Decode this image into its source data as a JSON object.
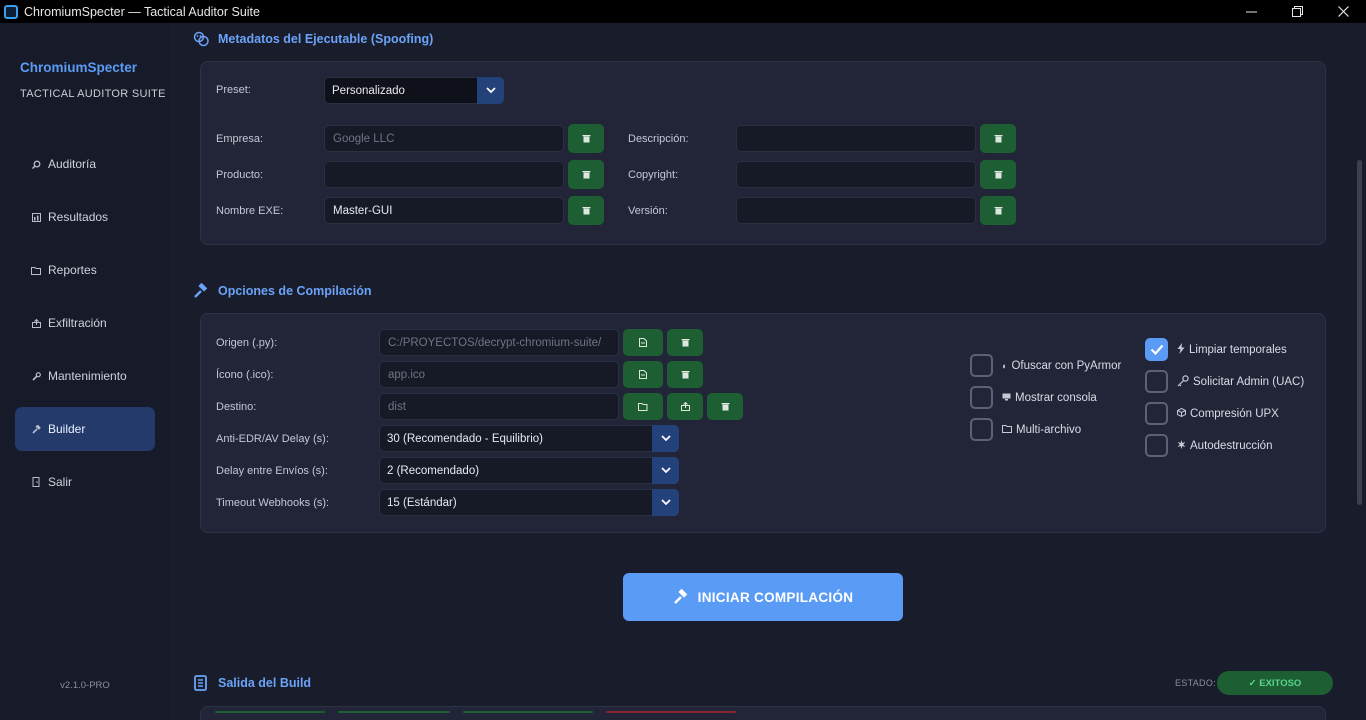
{
  "window": {
    "title": "ChromiumSpecter — Tactical Auditor Suite",
    "controls": {
      "minimize": "—",
      "restore": "❐",
      "close": "✕"
    }
  },
  "sidebar": {
    "brand": "ChromiumSpecter",
    "subtitle": "TACTICAL AUDITOR SUITE",
    "items": [
      {
        "label": "Auditoría",
        "icon": "magnifier-icon"
      },
      {
        "label": "Resultados",
        "icon": "chart-icon"
      },
      {
        "label": "Reportes",
        "icon": "folder-icon"
      },
      {
        "label": "Exfiltración",
        "icon": "upload-icon"
      },
      {
        "label": "Mantenimiento",
        "icon": "wrench-icon"
      },
      {
        "label": "Builder",
        "icon": "hammer-icon",
        "active": true
      },
      {
        "label": "Salir",
        "icon": "exit-icon"
      }
    ],
    "version": "v2.1.0-PRO"
  },
  "metadata": {
    "title": "Metadatos del Ejecutable (Spoofing)",
    "preset_label": "Preset:",
    "preset_value": "Personalizado",
    "fields": {
      "empresa": {
        "label": "Empresa:",
        "placeholder": "Google LLC",
        "value": ""
      },
      "producto": {
        "label": "Producto:",
        "value": ""
      },
      "nombre_exe": {
        "label": "Nombre EXE:",
        "value": "Master-GUI"
      },
      "descripcion": {
        "label": "Descripción:",
        "value": ""
      },
      "copyright": {
        "label": "Copyright:",
        "value": ""
      },
      "version": {
        "label": "Versión:",
        "value": ""
      }
    }
  },
  "compile": {
    "title": "Opciones de Compilación",
    "origen": {
      "label": "Origen (.py):",
      "placeholder": "C:/PROYECTOS/decrypt-chromium-suite/"
    },
    "icono": {
      "label": "Ícono (.ico):",
      "placeholder": "app.ico"
    },
    "destino": {
      "label": "Destino:",
      "placeholder": "dist"
    },
    "anti_edr": {
      "label": "Anti-EDR/AV Delay (s):",
      "value": "30 (Recomendado - Equilibrio)"
    },
    "delay_envios": {
      "label": "Delay entre Envíos (s):",
      "value": "2 (Recomendado)"
    },
    "timeout": {
      "label": "Timeout Webhooks (s):",
      "value": "15 (Estándar)"
    },
    "options_left": [
      {
        "label": "Ofuscar con PyArmor",
        "checked": false,
        "icon": "half-circle-icon"
      },
      {
        "label": "Mostrar consola",
        "checked": false,
        "icon": "monitor-icon"
      },
      {
        "label": "Multi-archivo",
        "checked": false,
        "icon": "folder-icon"
      }
    ],
    "options_right": [
      {
        "label": "Limpiar temporales",
        "checked": true,
        "icon": "bolt-icon"
      },
      {
        "label": "Solicitar Admin (UAC)",
        "checked": false,
        "icon": "key-icon"
      },
      {
        "label": "Compresión UPX",
        "checked": false,
        "icon": "cube-icon"
      },
      {
        "label": "Autodestrucción",
        "checked": false,
        "icon": "burst-icon"
      }
    ]
  },
  "build_button": "INICIAR COMPILACIÓN",
  "output": {
    "title": "Salida del Build",
    "estado_label": "ESTADO:",
    "estado_value": "✓ EXITOSO"
  },
  "colors": {
    "accent": "#5a9cf5",
    "success_bg": "#1d5e33",
    "success_text": "#58d68a",
    "sidebar_active": "#233a6b"
  }
}
